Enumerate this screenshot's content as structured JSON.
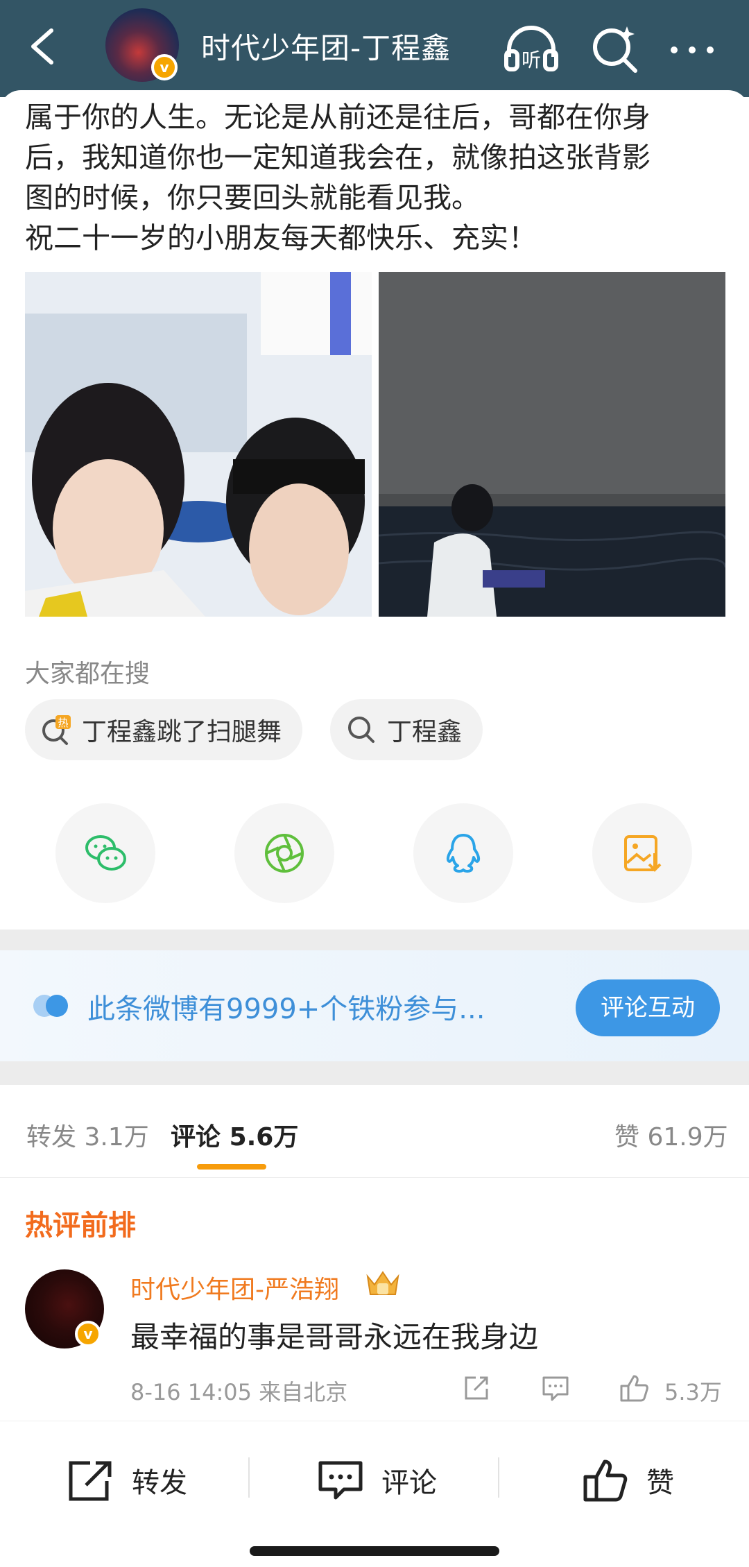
{
  "header": {
    "title": "时代少年团-丁程鑫",
    "back_icon": "chevron-left-icon",
    "listen_icon": "headphones-listen-icon",
    "listen_label": "听",
    "search_icon": "search-sparkle-icon",
    "more_icon": "more-dots-icon",
    "verified_badge": "v"
  },
  "post": {
    "lines": [
      "属于你的人生。无论是从前还是往后，哥都在你身",
      "后，我知道你也一定知道我会在，就像拍这张背影",
      "图的时候，你只要回头就能看见我。",
      "祝二十一岁的小朋友每天都快乐、充实！"
    ]
  },
  "search": {
    "label": "大家都在搜",
    "chips": [
      {
        "text": "丁程鑫跳了扫腿舞",
        "icon": "hot-search-icon",
        "badge": "热"
      },
      {
        "text": "丁程鑫",
        "icon": "search-icon"
      }
    ]
  },
  "share": {
    "items": [
      {
        "name": "wechat",
        "icon": "wechat-icon",
        "color": "#2dbd6a"
      },
      {
        "name": "moments",
        "icon": "moments-icon",
        "color": "#5fbf3c"
      },
      {
        "name": "qq",
        "icon": "qq-icon",
        "color": "#2aa4e8"
      },
      {
        "name": "save-image",
        "icon": "save-image-icon",
        "color": "#f5a623"
      }
    ]
  },
  "fan_banner": {
    "text": "此条微博有9999+个铁粉参与...",
    "button": "评论互动"
  },
  "tabs": {
    "repost": "转发",
    "repost_count": "3.1万",
    "comment": "评论",
    "comment_count": "5.6万",
    "like": "赞",
    "like_count": "61.9万"
  },
  "hot_comments": {
    "title": "热评前排",
    "items": [
      {
        "author": "时代少年团-严浩翔",
        "text": "最幸福的事是哥哥永远在我身边",
        "time": "8-16 14:05",
        "location": "来自北京",
        "likes": "5.3万"
      }
    ]
  },
  "bottom_bar": {
    "repost": "转发",
    "comment": "评论",
    "like": "赞"
  },
  "colors": {
    "header_bg": "#335565",
    "accent_orange": "#f79c0c",
    "hot_title": "#f26b1d",
    "link_blue": "#3e8fd8",
    "button_blue": "#3d97e5"
  }
}
